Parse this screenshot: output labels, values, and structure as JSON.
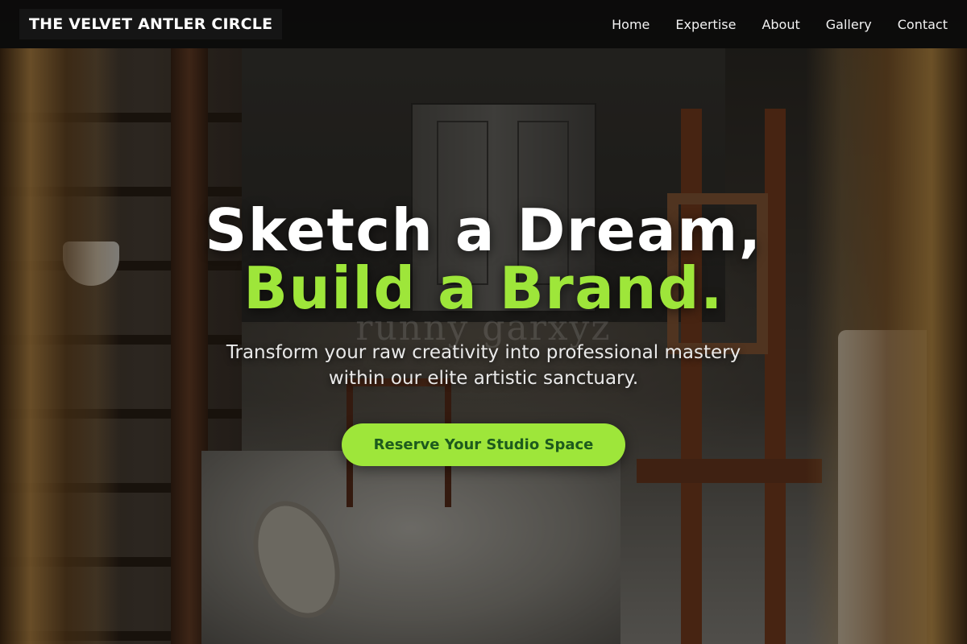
{
  "site": {
    "brand": "THE VELVET ANTLER CIRCLE"
  },
  "nav": {
    "items": [
      {
        "label": "Home"
      },
      {
        "label": "Expertise"
      },
      {
        "label": "About"
      },
      {
        "label": "Gallery"
      },
      {
        "label": "Contact"
      }
    ]
  },
  "hero": {
    "headline_line1": "Sketch a Dream,",
    "headline_line2": "Build a Brand.",
    "background_text": "runny garxyz",
    "subheading": "Transform your raw creativity into professional mastery within our elite artistic sanctuary.",
    "cta_label": "Reserve Your Studio Space"
  },
  "colors": {
    "accent": "#9ee63a",
    "cta_text": "#1d5a1d",
    "nav_bg": "#0a0a0a"
  }
}
